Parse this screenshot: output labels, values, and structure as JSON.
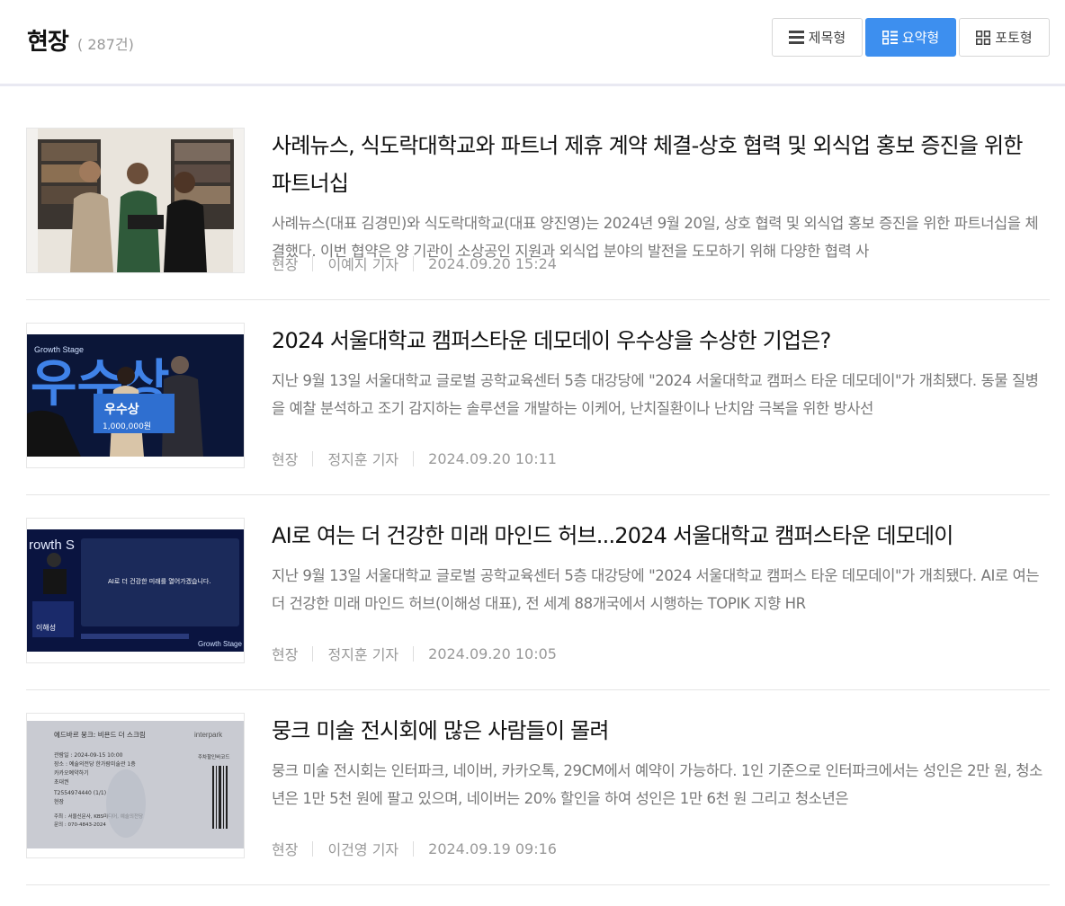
{
  "section": {
    "title": "현장",
    "count": "( 287건)"
  },
  "view_modes": [
    {
      "label": "제목형",
      "icon": "list-icon",
      "active": false
    },
    {
      "label": "요약형",
      "icon": "summary-grid-icon",
      "active": true
    },
    {
      "label": "포토형",
      "icon": "photo-grid-icon",
      "active": false
    }
  ],
  "articles": [
    {
      "title": "사례뉴스, 식도락대학교와 파트너 제휴 계약 체결-상호 협력 및 외식업 홍보 증진을 위한 파트너십",
      "summary": "사례뉴스(대표 김경민)와 식도락대학교(대표 양진영)는 2024년 9월 20일, 상호 협력 및 외식업 홍보 증진을 위한 파트너십을 체결했다. 이번 협약은 양 기관이 소상공인 지원과 외식업 분야의 발전을 도모하기 위해 다양한 협력 사",
      "category": "현장",
      "author": "이예지 기자",
      "date": "2024.09.20 15:24"
    },
    {
      "title": "2024 서울대학교 캠퍼스타운 데모데이 우수상을 수상한 기업은?",
      "summary": "지난 9월 13일 서울대학교 글로벌 공학교육센터 5층 대강당에 \"2024 서울대학교 캠퍼스 타운 데모데이\"가 개최됐다. 동물 질병을 예찰 분석하고 조기 감지하는 솔루션을 개발하는 이케어, 난치질환이나 난치암 극복을 위한 방사선",
      "category": "현장",
      "author": "정지훈 기자",
      "date": "2024.09.20 10:11"
    },
    {
      "title": "AI로 여는 더 건강한 미래 마인드 허브...2024 서울대학교 캠퍼스타운 데모데이",
      "summary": "지난 9월 13일 서울대학교 글로벌 공학교육센터 5층 대강당에 \"2024 서울대학교 캠퍼스 타운 데모데이\"가 개최됐다. AI로 여는 더 건강한 미래 마인드 허브(이해성 대표), 전 세계 88개국에서 시행하는 TOPIK 지향 HR",
      "category": "현장",
      "author": "정지훈 기자",
      "date": "2024.09.20 10:05"
    },
    {
      "title": "뭉크 미술 전시회에 많은 사람들이 몰려",
      "summary": "뭉크 미술 전시회는 인터파크, 네이버, 카카오톡, 29CM에서 예약이 가능하다. 1인 기준으로 인터파크에서는 성인은 2만 원, 청소년은 1만 5천 원에 팔고 있으며, 네이버는 20% 할인을 하여 성인은 1만 6천 원 그리고 청소년은",
      "category": "현장",
      "author": "이건영 기자",
      "date": "2024.09.19 09:16"
    }
  ],
  "photo_texts": {
    "p2_banner": "우수상",
    "p2_stage": "Growth Stage",
    "p2_prize": "우수상",
    "p2_amount": "1,000,000원",
    "p3_stage_top": "rowth S",
    "p3_screen": "AI로 더 건강한 미래를 열어가겠습니다.",
    "p3_speaker": "이해성",
    "p3_stage_bottom": "Growth Stage",
    "p4_head": "에드바르 뭉크: 비욘드 더 스크림",
    "p4_brand": "interpark",
    "p4_line1": "관람일 : 2024-09-15 10:00",
    "p4_line2": "장소 : 예술의전당 한가람미술관 1층",
    "p4_line3": "카카오예약하기",
    "p4_line4": "초대권",
    "p4_line5": "T2554974440    (1/1)",
    "p4_line6": "현장",
    "p4_barcode": "주차할인바코드",
    "p4_foot1": "주최 : 서울신문사, KBS미디어, 예술의전당",
    "p4_foot2": "문의 : 070-4843-2024"
  }
}
